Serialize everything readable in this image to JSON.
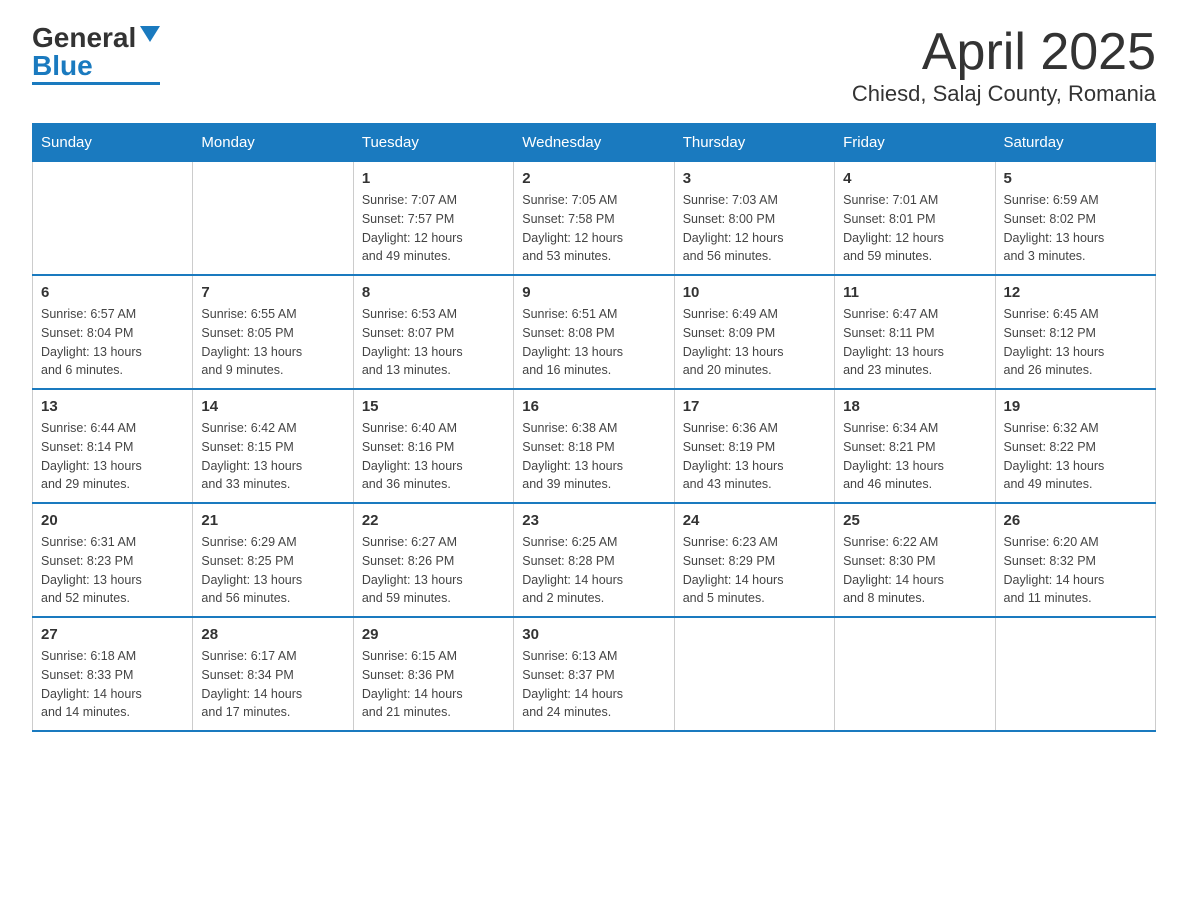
{
  "logo": {
    "general": "General",
    "blue": "Blue"
  },
  "title": "April 2025",
  "subtitle": "Chiesd, Salaj County, Romania",
  "days_of_week": [
    "Sunday",
    "Monday",
    "Tuesday",
    "Wednesday",
    "Thursday",
    "Friday",
    "Saturday"
  ],
  "weeks": [
    [
      {
        "day": "",
        "info": ""
      },
      {
        "day": "",
        "info": ""
      },
      {
        "day": "1",
        "info": "Sunrise: 7:07 AM\nSunset: 7:57 PM\nDaylight: 12 hours\nand 49 minutes."
      },
      {
        "day": "2",
        "info": "Sunrise: 7:05 AM\nSunset: 7:58 PM\nDaylight: 12 hours\nand 53 minutes."
      },
      {
        "day": "3",
        "info": "Sunrise: 7:03 AM\nSunset: 8:00 PM\nDaylight: 12 hours\nand 56 minutes."
      },
      {
        "day": "4",
        "info": "Sunrise: 7:01 AM\nSunset: 8:01 PM\nDaylight: 12 hours\nand 59 minutes."
      },
      {
        "day": "5",
        "info": "Sunrise: 6:59 AM\nSunset: 8:02 PM\nDaylight: 13 hours\nand 3 minutes."
      }
    ],
    [
      {
        "day": "6",
        "info": "Sunrise: 6:57 AM\nSunset: 8:04 PM\nDaylight: 13 hours\nand 6 minutes."
      },
      {
        "day": "7",
        "info": "Sunrise: 6:55 AM\nSunset: 8:05 PM\nDaylight: 13 hours\nand 9 minutes."
      },
      {
        "day": "8",
        "info": "Sunrise: 6:53 AM\nSunset: 8:07 PM\nDaylight: 13 hours\nand 13 minutes."
      },
      {
        "day": "9",
        "info": "Sunrise: 6:51 AM\nSunset: 8:08 PM\nDaylight: 13 hours\nand 16 minutes."
      },
      {
        "day": "10",
        "info": "Sunrise: 6:49 AM\nSunset: 8:09 PM\nDaylight: 13 hours\nand 20 minutes."
      },
      {
        "day": "11",
        "info": "Sunrise: 6:47 AM\nSunset: 8:11 PM\nDaylight: 13 hours\nand 23 minutes."
      },
      {
        "day": "12",
        "info": "Sunrise: 6:45 AM\nSunset: 8:12 PM\nDaylight: 13 hours\nand 26 minutes."
      }
    ],
    [
      {
        "day": "13",
        "info": "Sunrise: 6:44 AM\nSunset: 8:14 PM\nDaylight: 13 hours\nand 29 minutes."
      },
      {
        "day": "14",
        "info": "Sunrise: 6:42 AM\nSunset: 8:15 PM\nDaylight: 13 hours\nand 33 minutes."
      },
      {
        "day": "15",
        "info": "Sunrise: 6:40 AM\nSunset: 8:16 PM\nDaylight: 13 hours\nand 36 minutes."
      },
      {
        "day": "16",
        "info": "Sunrise: 6:38 AM\nSunset: 8:18 PM\nDaylight: 13 hours\nand 39 minutes."
      },
      {
        "day": "17",
        "info": "Sunrise: 6:36 AM\nSunset: 8:19 PM\nDaylight: 13 hours\nand 43 minutes."
      },
      {
        "day": "18",
        "info": "Sunrise: 6:34 AM\nSunset: 8:21 PM\nDaylight: 13 hours\nand 46 minutes."
      },
      {
        "day": "19",
        "info": "Sunrise: 6:32 AM\nSunset: 8:22 PM\nDaylight: 13 hours\nand 49 minutes."
      }
    ],
    [
      {
        "day": "20",
        "info": "Sunrise: 6:31 AM\nSunset: 8:23 PM\nDaylight: 13 hours\nand 52 minutes."
      },
      {
        "day": "21",
        "info": "Sunrise: 6:29 AM\nSunset: 8:25 PM\nDaylight: 13 hours\nand 56 minutes."
      },
      {
        "day": "22",
        "info": "Sunrise: 6:27 AM\nSunset: 8:26 PM\nDaylight: 13 hours\nand 59 minutes."
      },
      {
        "day": "23",
        "info": "Sunrise: 6:25 AM\nSunset: 8:28 PM\nDaylight: 14 hours\nand 2 minutes."
      },
      {
        "day": "24",
        "info": "Sunrise: 6:23 AM\nSunset: 8:29 PM\nDaylight: 14 hours\nand 5 minutes."
      },
      {
        "day": "25",
        "info": "Sunrise: 6:22 AM\nSunset: 8:30 PM\nDaylight: 14 hours\nand 8 minutes."
      },
      {
        "day": "26",
        "info": "Sunrise: 6:20 AM\nSunset: 8:32 PM\nDaylight: 14 hours\nand 11 minutes."
      }
    ],
    [
      {
        "day": "27",
        "info": "Sunrise: 6:18 AM\nSunset: 8:33 PM\nDaylight: 14 hours\nand 14 minutes."
      },
      {
        "day": "28",
        "info": "Sunrise: 6:17 AM\nSunset: 8:34 PM\nDaylight: 14 hours\nand 17 minutes."
      },
      {
        "day": "29",
        "info": "Sunrise: 6:15 AM\nSunset: 8:36 PM\nDaylight: 14 hours\nand 21 minutes."
      },
      {
        "day": "30",
        "info": "Sunrise: 6:13 AM\nSunset: 8:37 PM\nDaylight: 14 hours\nand 24 minutes."
      },
      {
        "day": "",
        "info": ""
      },
      {
        "day": "",
        "info": ""
      },
      {
        "day": "",
        "info": ""
      }
    ]
  ]
}
